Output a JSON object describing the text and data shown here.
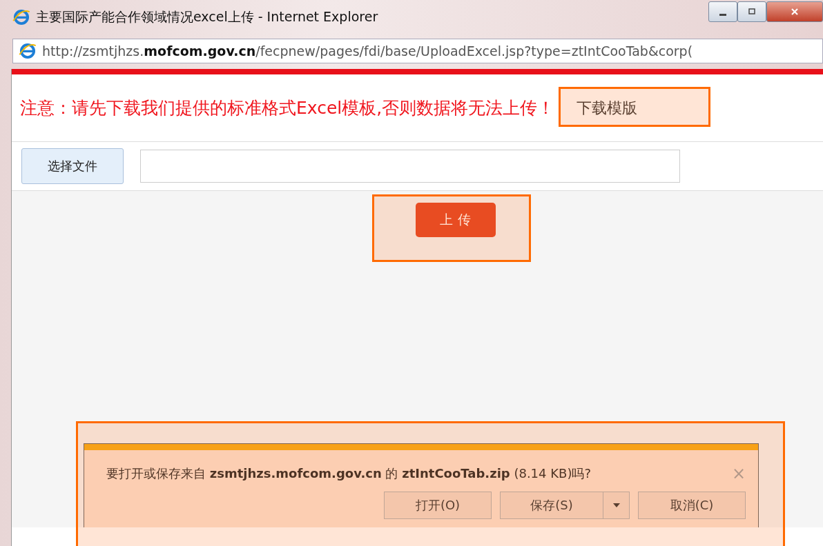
{
  "window": {
    "title": "主要国际产能合作领域情况excel上传 - Internet Explorer"
  },
  "address_bar": {
    "url": "http://zsmtjhzs.**mofcom.gov.cn**/fecpnew/pages/fdi/base/UploadExcel.jsp?type=ztIntCooTab&corp("
  },
  "notice": {
    "text": "注意：请先下载我们提供的标准格式Excel模板,否则数据将无法上传！",
    "link": "下载模版"
  },
  "file_row": {
    "button": "选择文件"
  },
  "upload_button": "上 传",
  "download_bar": {
    "message": "要打开或保存来自 **zsmtjhzs.mofcom.gov.cn** 的 **ztIntCooTab.zip** (8.14 KB)吗?",
    "close": "×",
    "buttons": [
      {
        "label": "打开(O)",
        "kind": "plain"
      },
      {
        "label": "保存(S)",
        "kind": "split"
      },
      {
        "label": "取消(C)",
        "kind": "plain"
      }
    ]
  }
}
